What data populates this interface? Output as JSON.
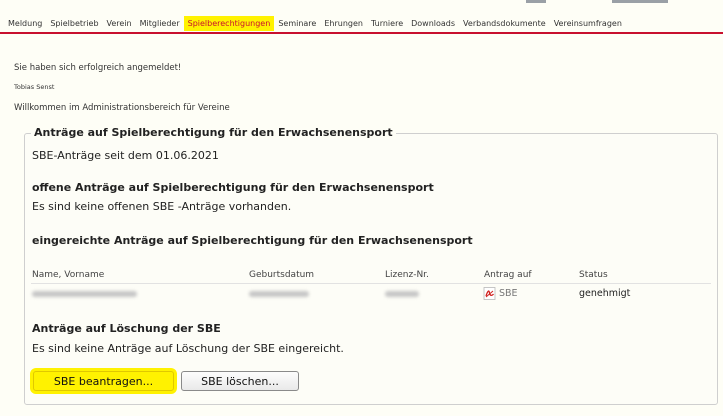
{
  "nav": {
    "items": [
      {
        "label": "Meldung"
      },
      {
        "label": "Spielbetrieb"
      },
      {
        "label": "Verein"
      },
      {
        "label": "Mitglieder"
      },
      {
        "label": "Spielberechtigungen",
        "active": true
      },
      {
        "label": "Seminare"
      },
      {
        "label": "Ehrungen"
      },
      {
        "label": "Turniere"
      },
      {
        "label": "Downloads"
      },
      {
        "label": "Verbandsdokumente"
      },
      {
        "label": "Vereinsumfragen"
      }
    ]
  },
  "messages": {
    "login_success": "Sie haben sich erfolgreich angemeldet!",
    "user_name": "Tobias Senst",
    "welcome": "Willkommen im Administrationsbereich für Vereine"
  },
  "panel": {
    "legend": "Anträge auf Spielberechtigung für den Erwachsenensport",
    "since": "SBE-Anträge seit dem 01.06.2021",
    "open_heading": "offene Anträge auf Spielberechtigung für den Erwachsenensport",
    "open_text": "Es sind keine offenen SBE -Anträge vorhanden.",
    "submitted_heading": "eingereichte Anträge auf Spielberechtigung für den Erwachsenensport",
    "table": {
      "headers": [
        "Name, Vorname",
        "Geburtsdatum",
        "Lizenz-Nr.",
        "Antrag auf",
        "Status"
      ],
      "row": {
        "antrag": "SBE",
        "status": "genehmigt"
      }
    },
    "delete_heading": "Anträge auf Löschung der SBE",
    "delete_text": "Es sind keine Anträge auf Löschung der SBE eingereicht."
  },
  "buttons": {
    "apply_label": "SBE beantragen...",
    "delete_label": "SBE löschen..."
  },
  "colors": {
    "accent_red": "#c8102e",
    "highlight_yellow": "#fff200"
  },
  "icons": {
    "pdf": "pdf-icon"
  }
}
